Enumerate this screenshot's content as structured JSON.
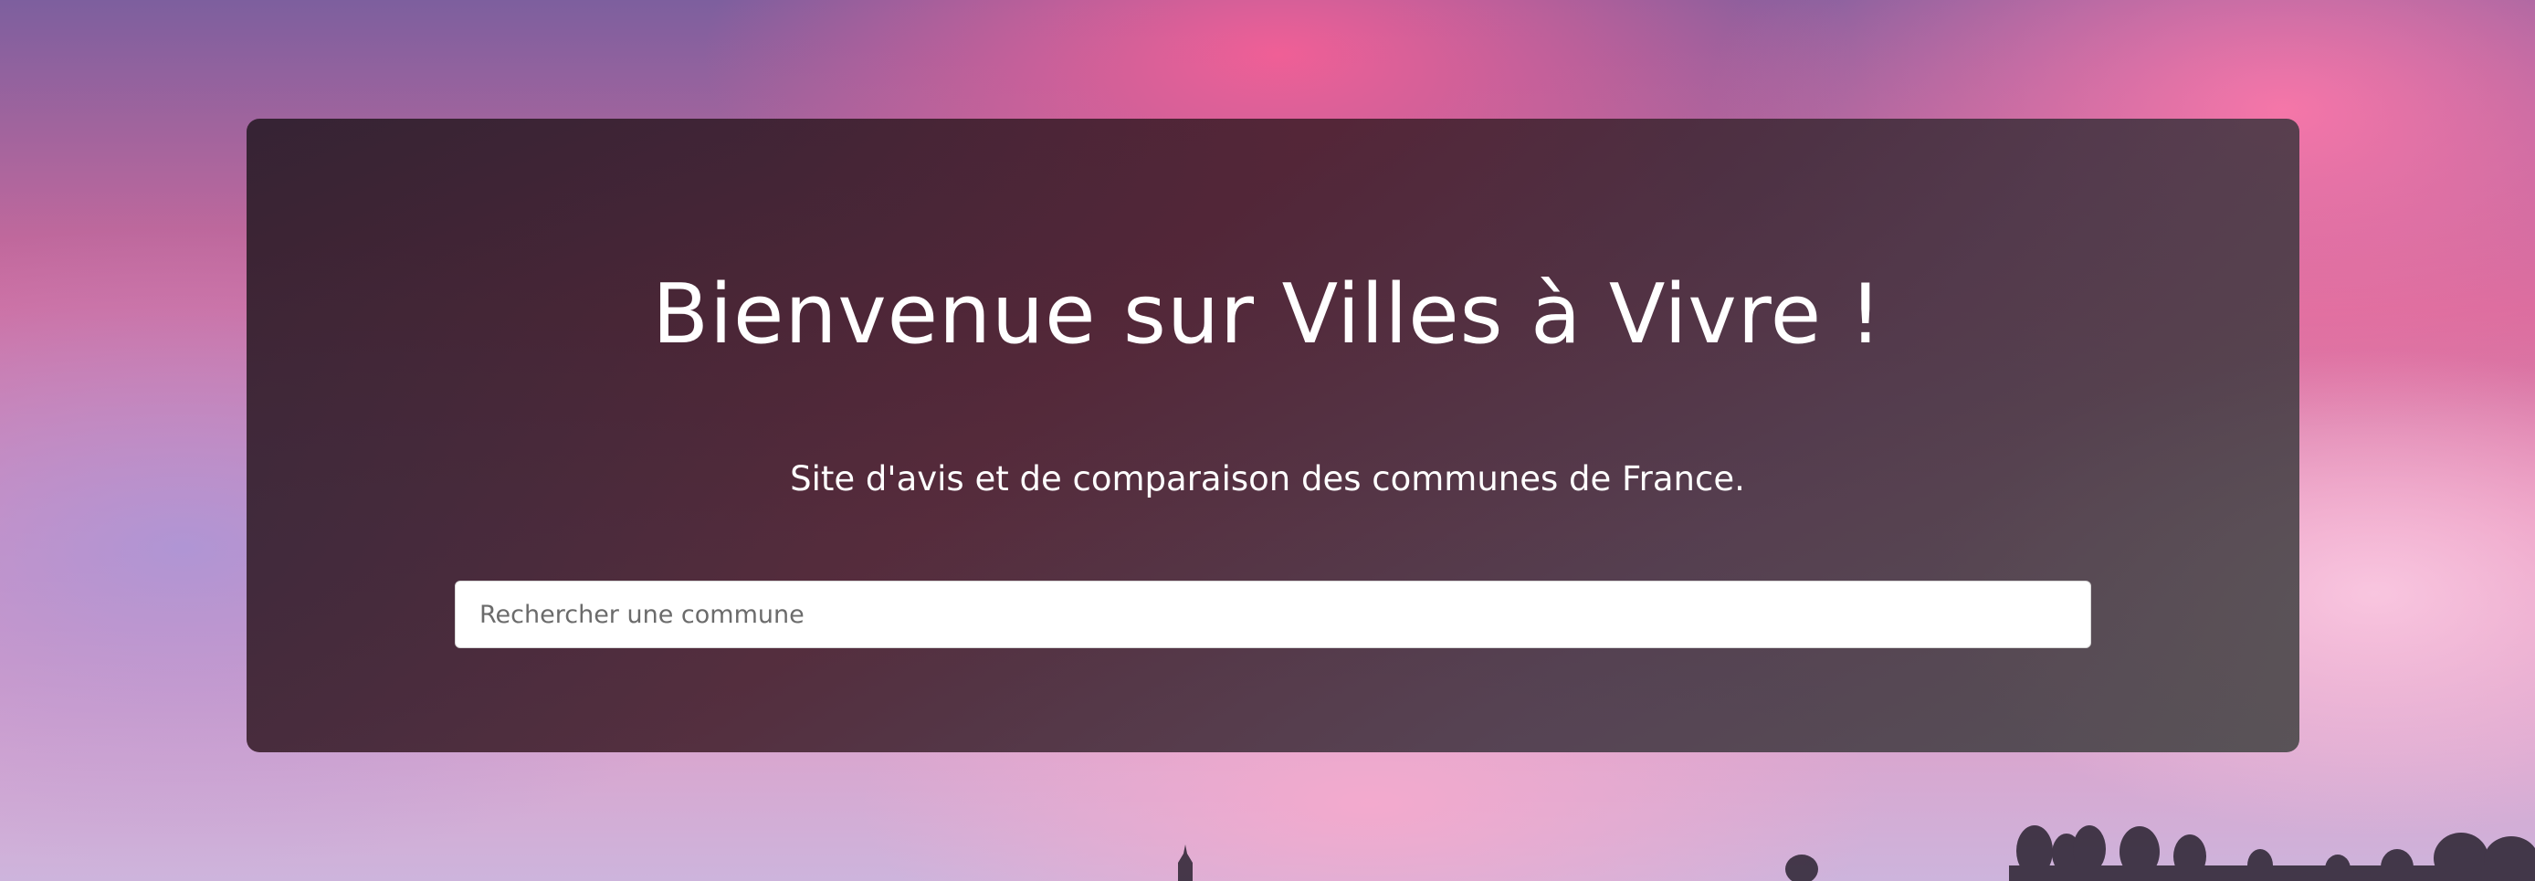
{
  "hero": {
    "title": "Bienvenue sur Villes à Vivre !",
    "subtitle": "Site d'avis et de comparaison des communes de France."
  },
  "search": {
    "placeholder": "Rechercher une commune",
    "value": ""
  },
  "colors": {
    "card_background": "#3a2a33",
    "text": "#ffffff",
    "sky_pink": "#f06aa0",
    "sky_purple": "#8a6cab"
  }
}
